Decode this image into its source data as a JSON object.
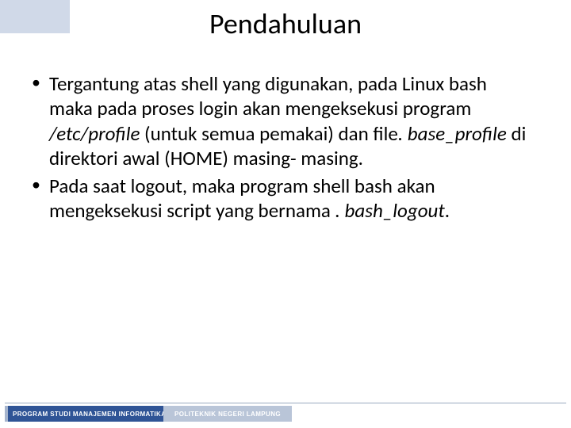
{
  "title": "Pendahuluan",
  "bullets": [
    {
      "segments": [
        {
          "t": "Tergantung atas shell yang digunakan, pada Linux bash maka pada proses login akan mengeksekusi program ",
          "i": false
        },
        {
          "t": "/etc/profile",
          "i": true
        },
        {
          "t": " (untuk semua pemakai) dan file",
          "i": false
        },
        {
          "t": ". base_profile ",
          "i": true
        },
        {
          "t": "di direktori awal (HOME) masing- masing.",
          "i": false
        }
      ]
    },
    {
      "segments": [
        {
          "t": "Pada saat logout, maka program shell bash akan mengeksekusi script yang bernama ",
          "i": false
        },
        {
          "t": ". bash_logout",
          "i": true
        },
        {
          "t": ".",
          "i": false
        }
      ]
    }
  ],
  "footer": {
    "left": "PROGRAM STUDI MANAJEMEN INFORMATIKA",
    "right": "POLITEKNIK NEGERI LAMPUNG"
  }
}
